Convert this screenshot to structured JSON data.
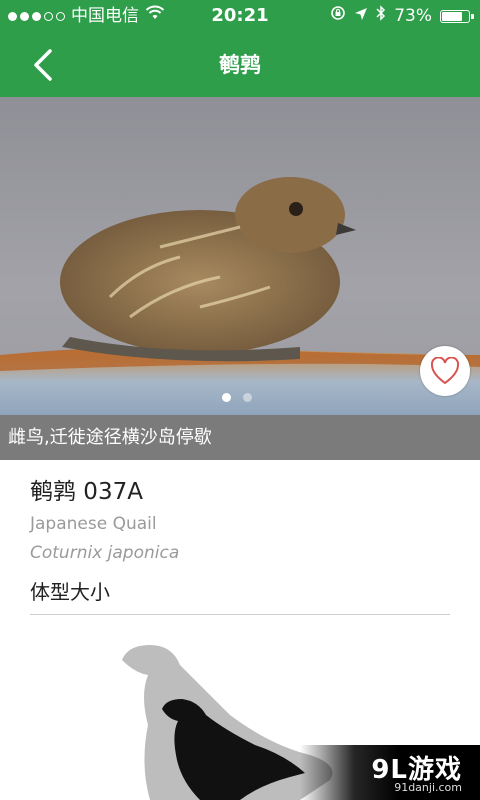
{
  "status_bar": {
    "carrier": "中国电信",
    "time": "20:21",
    "battery": "73%",
    "icons": [
      "signal-dots",
      "wifi-icon",
      "rotation-lock-icon",
      "location-arrow-icon",
      "bluetooth-icon",
      "battery-icon"
    ]
  },
  "nav": {
    "title": "鹌鹑",
    "back_icon": "chevron-left-icon"
  },
  "photo": {
    "favorite_icon": "heart-outline-icon",
    "pager_total": 2,
    "pager_active": 1,
    "caption": "雌鸟,迁徙途径横沙岛停歇"
  },
  "bird": {
    "name_line": "鹌鹑 037A",
    "english_name": "Japanese Quail",
    "scientific_name": "Coturnix japonica",
    "size_section_title": "体型大小"
  },
  "watermark": {
    "main": "9L游戏",
    "sub": "91danji.com"
  },
  "colors": {
    "header_green": "#2e9e4a",
    "caption_bg": "#7b7b7b",
    "heart_red": "#d9534f"
  }
}
